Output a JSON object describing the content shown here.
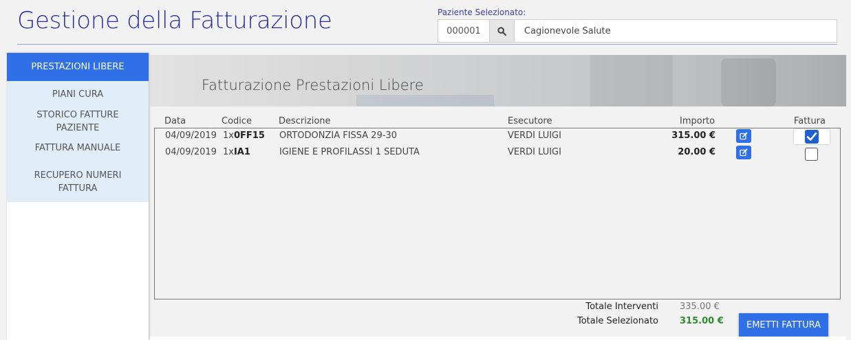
{
  "header": {
    "title": "Gestione della Fatturazione",
    "patient_label": "Paziente Selezionato:",
    "patient_code": "000001",
    "patient_name": "Cagionevole Salute"
  },
  "sidebar": {
    "items": [
      {
        "label": "PRESTAZIONI LIBERE",
        "active": true
      },
      {
        "label": "PIANI CURA"
      },
      {
        "label": "STORICO FATTURE PAZIENTE"
      },
      {
        "label": "FATTURA MANUALE"
      },
      {
        "label": "RECUPERO NUMERI FATTURA"
      }
    ]
  },
  "banner": {
    "title": "Fatturazione Prestazioni Libere"
  },
  "table": {
    "headers": {
      "date": "Data",
      "code": "Codice",
      "description": "Descrizione",
      "executor": "Esecutore",
      "amount": "Importo",
      "invoice": "Fattura"
    },
    "rows": [
      {
        "date": "04/09/2019",
        "qty": "1x",
        "code": "0FF15",
        "description": "ORTODONZIA FISSA 29-30",
        "executor": "VERDI LUIGI",
        "amount": "315.00 €",
        "checked": true
      },
      {
        "date": "04/09/2019",
        "qty": "1x",
        "code": "IA1",
        "description": "IGIENE E PROFILASSI 1 SEDUTA",
        "executor": "VERDI LUIGI",
        "amount": "20.00 €",
        "checked": false
      }
    ]
  },
  "totals": {
    "interventions_label": "Totale Interventi",
    "interventions_value": "335.00 €",
    "selected_label": "Totale Selezionato",
    "selected_value": "315.00 €"
  },
  "actions": {
    "emit_label": "EMETTI FATTURA"
  },
  "colors": {
    "accent": "#2f6fe8",
    "title": "#2b2e9a",
    "selected_total": "#2e8b2e",
    "sidebar_bg": "#e1eef9"
  }
}
